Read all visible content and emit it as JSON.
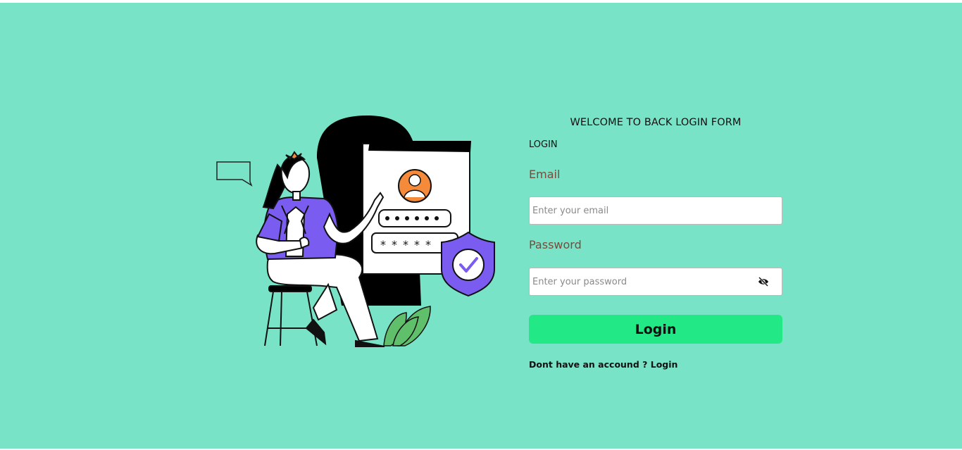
{
  "form": {
    "title": "WELCOME TO BACK LOGIN FORM",
    "subtitle": "LOGIN",
    "email_label": "Email",
    "email_placeholder": "Enter your email",
    "password_label": "Password",
    "password_placeholder": "Enter your password",
    "login_button": "Login",
    "signup_text": "Dont have an accound ? Login"
  },
  "icons": {
    "password_toggle": "eye-off-icon",
    "illustration_avatar": "user-icon",
    "illustration_shield": "shield-check-icon"
  },
  "colors": {
    "background": "#79e3c8",
    "button": "#22e886",
    "label": "#7a4a3a",
    "illustration_accent": "#7b5cf0",
    "avatar": "#f58a3a"
  }
}
